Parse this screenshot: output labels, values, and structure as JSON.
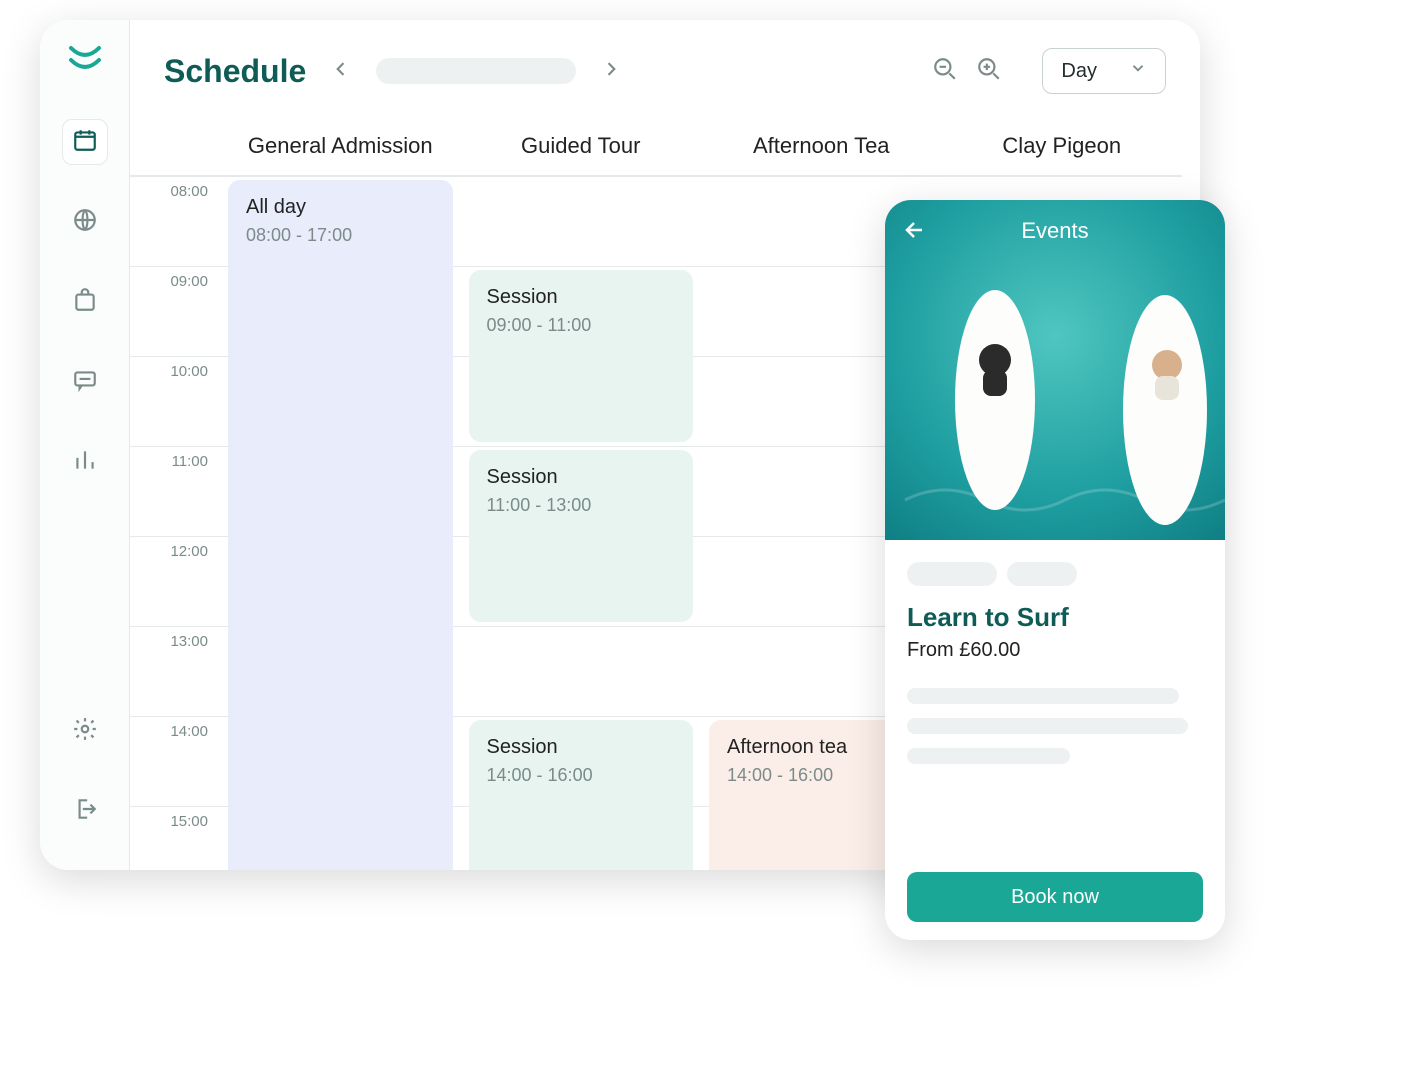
{
  "header": {
    "title": "Schedule",
    "view": "Day"
  },
  "columns": [
    "General Admission",
    "Guided Tour",
    "Afternoon Tea",
    "Clay Pigeon"
  ],
  "times": [
    "08:00",
    "09:00",
    "10:00",
    "11:00",
    "12:00",
    "13:00",
    "14:00",
    "15:00"
  ],
  "events": [
    {
      "col": 0,
      "title": "All day",
      "time": "08:00 - 17:00",
      "style": "ev-blue",
      "row_start": 2,
      "row_end": 10
    },
    {
      "col": 1,
      "title": "Session",
      "time": "09:00 - 11:00",
      "style": "ev-mint",
      "row_start": 3,
      "row_end": 5
    },
    {
      "col": 1,
      "title": "Session",
      "time": "11:00 - 13:00",
      "style": "ev-mint",
      "row_start": 5,
      "row_end": 7
    },
    {
      "col": 1,
      "title": "Session",
      "time": "14:00 - 16:00",
      "style": "ev-mint",
      "row_start": 8,
      "row_end": 10
    },
    {
      "col": 2,
      "title": "Afternoon tea",
      "time": "14:00 - 16:00",
      "style": "ev-peach",
      "row_start": 8,
      "row_end": 10
    }
  ],
  "mobile": {
    "section": "Events",
    "title": "Learn to Surf",
    "price": "From £60.00",
    "cta": "Book now"
  },
  "icons": {
    "logo": "brand-logo",
    "calendar": "calendar-icon",
    "globe": "globe-icon",
    "bag": "shopping-bag-icon",
    "chat": "message-icon",
    "chart": "bar-chart-icon",
    "gear": "gear-icon",
    "logout": "logout-icon",
    "prev": "chevron-left-icon",
    "next": "chevron-right-icon",
    "zoom_out": "zoom-out-icon",
    "zoom_in": "zoom-in-icon",
    "dropdown": "chevron-down-icon",
    "back": "arrow-left-icon"
  }
}
